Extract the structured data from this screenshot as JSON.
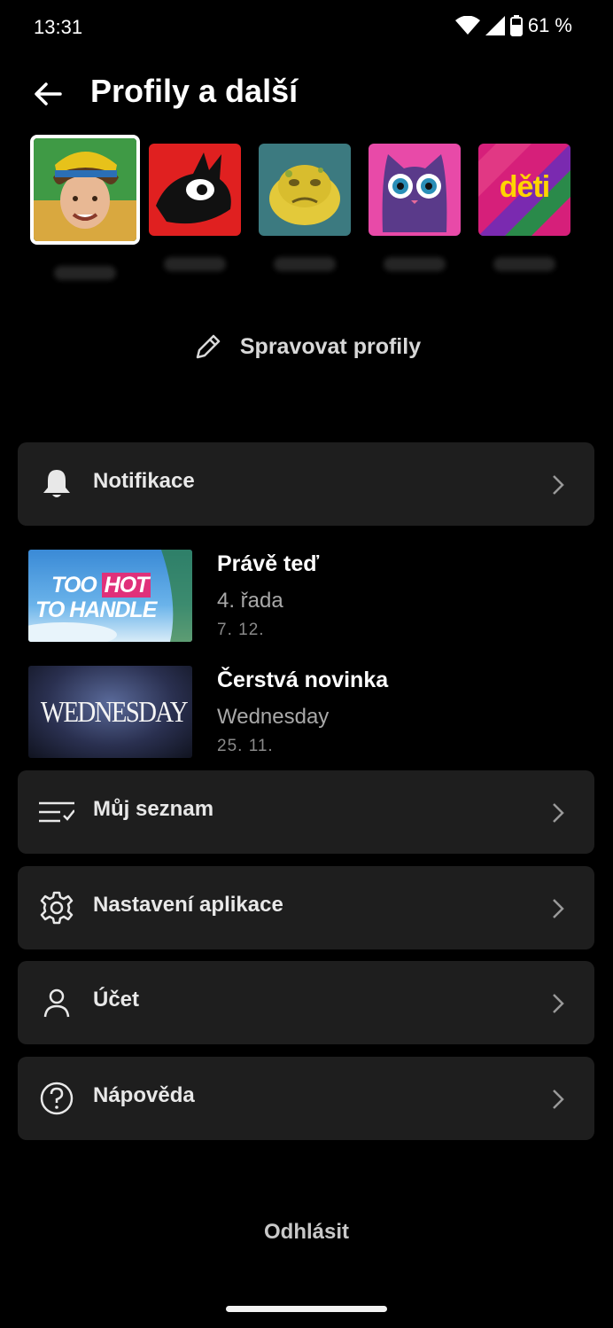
{
  "status_bar": {
    "time": "13:31",
    "battery": "61 %"
  },
  "header": {
    "title": "Profily a další"
  },
  "profiles": [
    {
      "name": "",
      "active": true
    },
    {
      "name": ""
    },
    {
      "name": ""
    },
    {
      "name": ""
    },
    {
      "name": "",
      "label": "děti"
    }
  ],
  "manage": {
    "label": "Spravovat profily"
  },
  "menu": {
    "notifications": "Notifikace",
    "my_list": "Můj seznam",
    "app_settings": "Nastavení aplikace",
    "account": "Účet",
    "help": "Nápověda"
  },
  "notifications": [
    {
      "thumb_text_line1_a": "TOO",
      "thumb_text_line1_b": "HOT",
      "thumb_text_line2": "TO HANDLE",
      "title": "Právě teď",
      "subtitle": "4. řada",
      "date": "7. 12."
    },
    {
      "thumb_text": "WEDNESDAY",
      "title": "Čerstvá novinka",
      "subtitle": "Wednesday",
      "date": "25. 11."
    }
  ],
  "logout": {
    "label": "Odhlásit"
  },
  "colors": {
    "background": "#000000",
    "row": "#1e1e1e",
    "kids_pink": "#d61f7a",
    "kids_yellow": "#ffd400"
  }
}
